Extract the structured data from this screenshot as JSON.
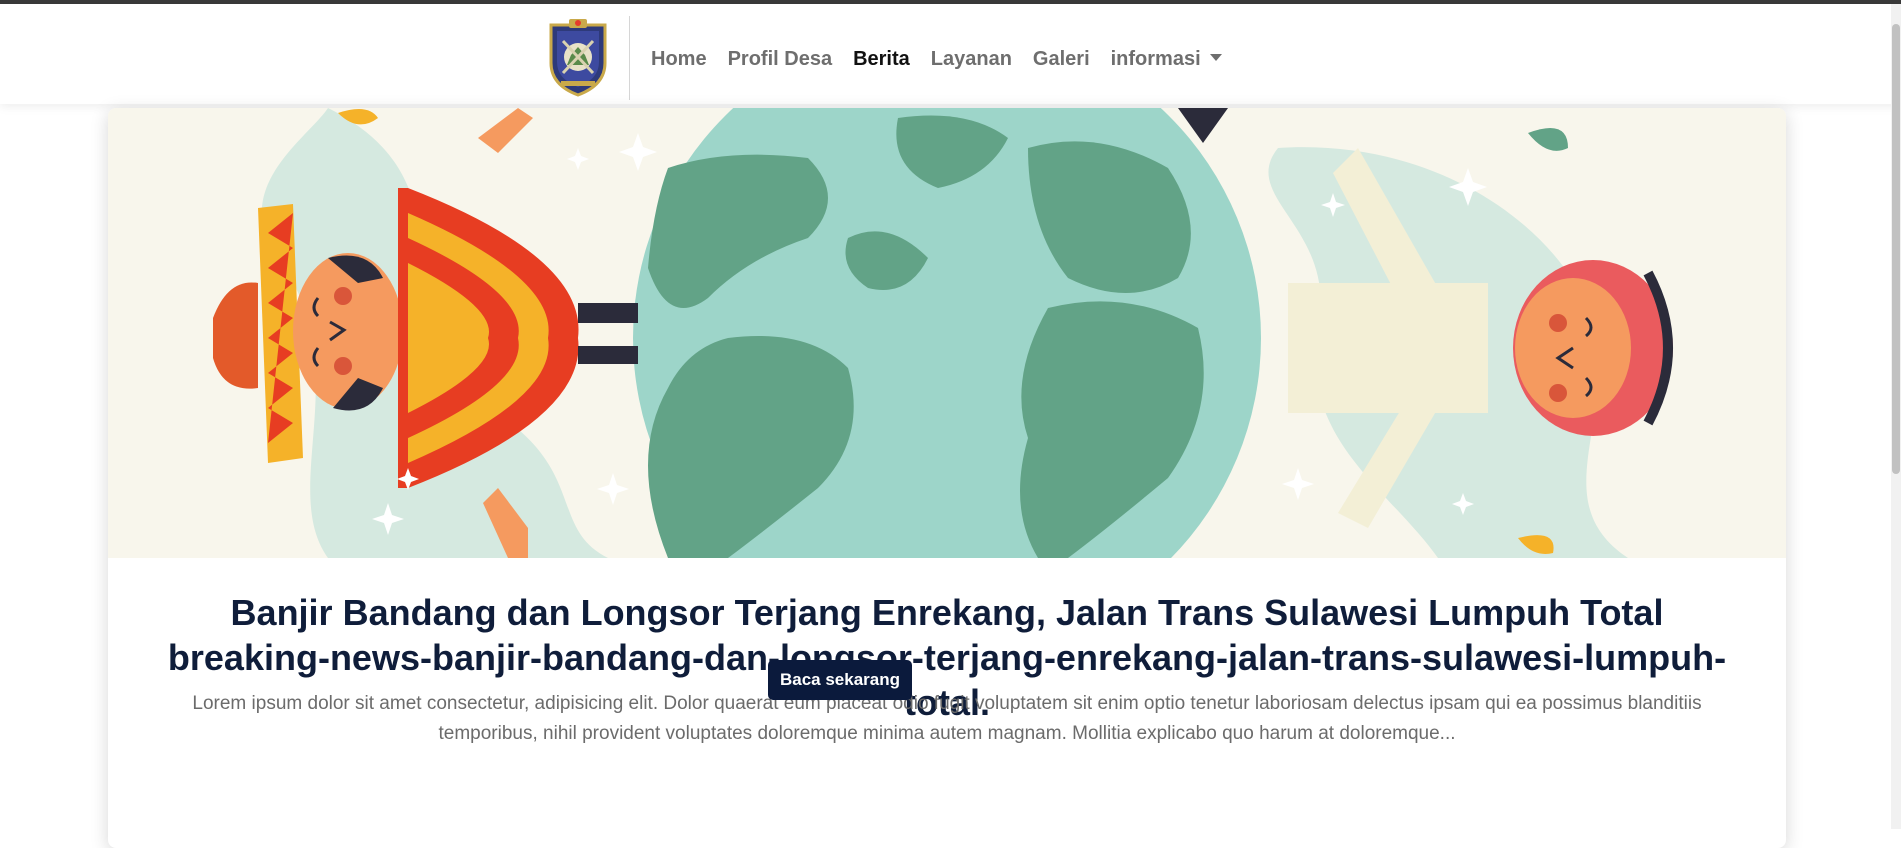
{
  "nav": {
    "logo_alt": "village-emblem-logo",
    "items": [
      {
        "label": "Home",
        "active": false
      },
      {
        "label": "Profil Desa",
        "active": false
      },
      {
        "label": "Berita",
        "active": true
      },
      {
        "label": "Layanan",
        "active": false
      },
      {
        "label": "Galeri",
        "active": false
      },
      {
        "label": "informasi",
        "active": false,
        "dropdown": true
      }
    ]
  },
  "article": {
    "title": "Banjir Bandang dan Longsor Terjang Enrekang, Jalan Trans Sulawesi Lumpuh Total breaking-news-banjir-bandang-dan-longsor-terjang-enrekang-jalan-trans-sulawesi-lumpuh-total.",
    "excerpt": "Lorem ipsum dolor sit amet consectetur, adipisicing elit. Dolor quaerat eum placeat odio fugit voluptatem sit enim optio tenetur laboriosam delectus ipsam qui ea possimus blanditiis temporibus, nihil provident voluptates doloremque minima autem magnam. Mollitia explicabo quo harum at doloremque...",
    "button_label": "Baca sekarang"
  },
  "colors": {
    "title": "#0f1d3a",
    "button_bg": "#0b1a3c",
    "ocean": "#9dd5c9",
    "land": "#62a387",
    "hero_bg": "#f8f6ec"
  }
}
